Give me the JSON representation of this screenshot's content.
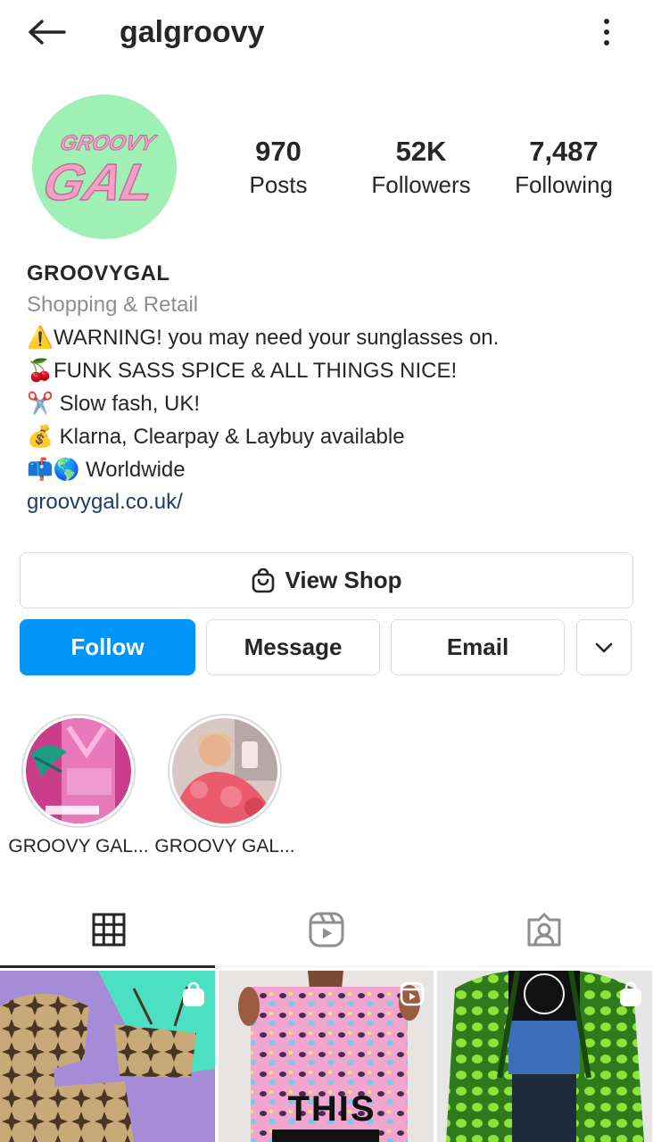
{
  "header": {
    "username": "galgroovy",
    "back_icon": "arrow-left-icon",
    "more_icon": "more-vertical-icon"
  },
  "profile": {
    "avatar_text_top": "GROOVY",
    "avatar_text_bottom": "GAL",
    "stats": [
      {
        "value": "970",
        "label": "Posts"
      },
      {
        "value": "52K",
        "label": "Followers"
      },
      {
        "value": "7,487",
        "label": "Following"
      }
    ]
  },
  "bio": {
    "name": "GROOVYGAL",
    "category": "Shopping & Retail",
    "lines": [
      {
        "emoji": "⚠️",
        "text": "WARNING! you may need your sunglasses on."
      },
      {
        "emoji": "🍒",
        "text": "FUNK SASS  SPICE & ALL THINGS NICE!"
      },
      {
        "emoji": "✂️",
        "text": " Slow fash, UK!"
      },
      {
        "emoji": "💰",
        "text": " Klarna, Clearpay & Laybuy available"
      },
      {
        "emoji": "📫🌎",
        "text": "Worldwide"
      }
    ],
    "link": "groovygal.co.uk/"
  },
  "buttons": {
    "view_shop": "View Shop",
    "follow": "Follow",
    "message": "Message",
    "email": "Email"
  },
  "highlights": [
    {
      "label": "GROOVY GAL..."
    },
    {
      "label": "GROOVY GAL..."
    }
  ],
  "tabs": [
    {
      "name": "grid",
      "icon": "grid-icon",
      "active": true
    },
    {
      "name": "reels",
      "icon": "reels-icon",
      "active": false
    },
    {
      "name": "tagged",
      "icon": "tagged-icon",
      "active": false
    }
  ],
  "posts": [
    {
      "badge": "shopping-bag-icon"
    },
    {
      "badge": "reels-icon",
      "overlay_text": "THIS"
    },
    {
      "badge": "shopping-bag-icon"
    }
  ],
  "colors": {
    "follow_blue": "#0095f6",
    "link": "#1f3a6b",
    "secondary_text": "#8e8e8e",
    "avatar_bg": "#9ef0b4",
    "avatar_text": "#f49fc7"
  }
}
